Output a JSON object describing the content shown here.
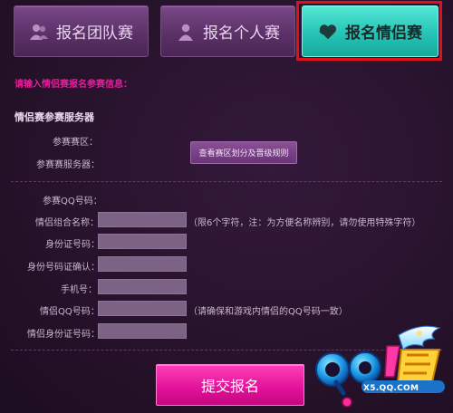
{
  "tabs": [
    {
      "label": "报名团队赛",
      "icon": "team-icon"
    },
    {
      "label": "报名个人赛",
      "icon": "person-icon"
    },
    {
      "label": "报名情侣赛",
      "icon": "heart-icon",
      "active": true
    }
  ],
  "notice": "请输入情侣赛报名参赛信息：",
  "section_title": "情侣赛参赛服务器",
  "server": {
    "region_label": "参赛赛区：",
    "server_label": "参赛赛服务器：",
    "rules_button": "查看赛区划分及晋级规则"
  },
  "form": {
    "qq_label": "参赛QQ号码：",
    "combo_name_label": "情侣组合名称：",
    "combo_name_hint": "（限6个字符，注：为方便名称辨别，请勿使用特殊字符）",
    "id_label": "身份证号码：",
    "id_confirm_label": "身份号码证确认：",
    "phone_label": "手机号：",
    "partner_qq_label": "情侣QQ号码：",
    "partner_qq_hint": "（请确保和游戏内情侣的QQ号码一致）",
    "partner_id_label": "情侣身份证号码："
  },
  "submit_label": "提交报名",
  "logo": {
    "url_text": "X5.QQ.COM"
  },
  "colors": {
    "background": "#241128",
    "tab": "#5c3168",
    "tab_active": "#25c4b6",
    "highlight_frame": "#e0101a",
    "notice": "#e0219a",
    "field": "#7c6285",
    "submit": "#e0119a"
  }
}
